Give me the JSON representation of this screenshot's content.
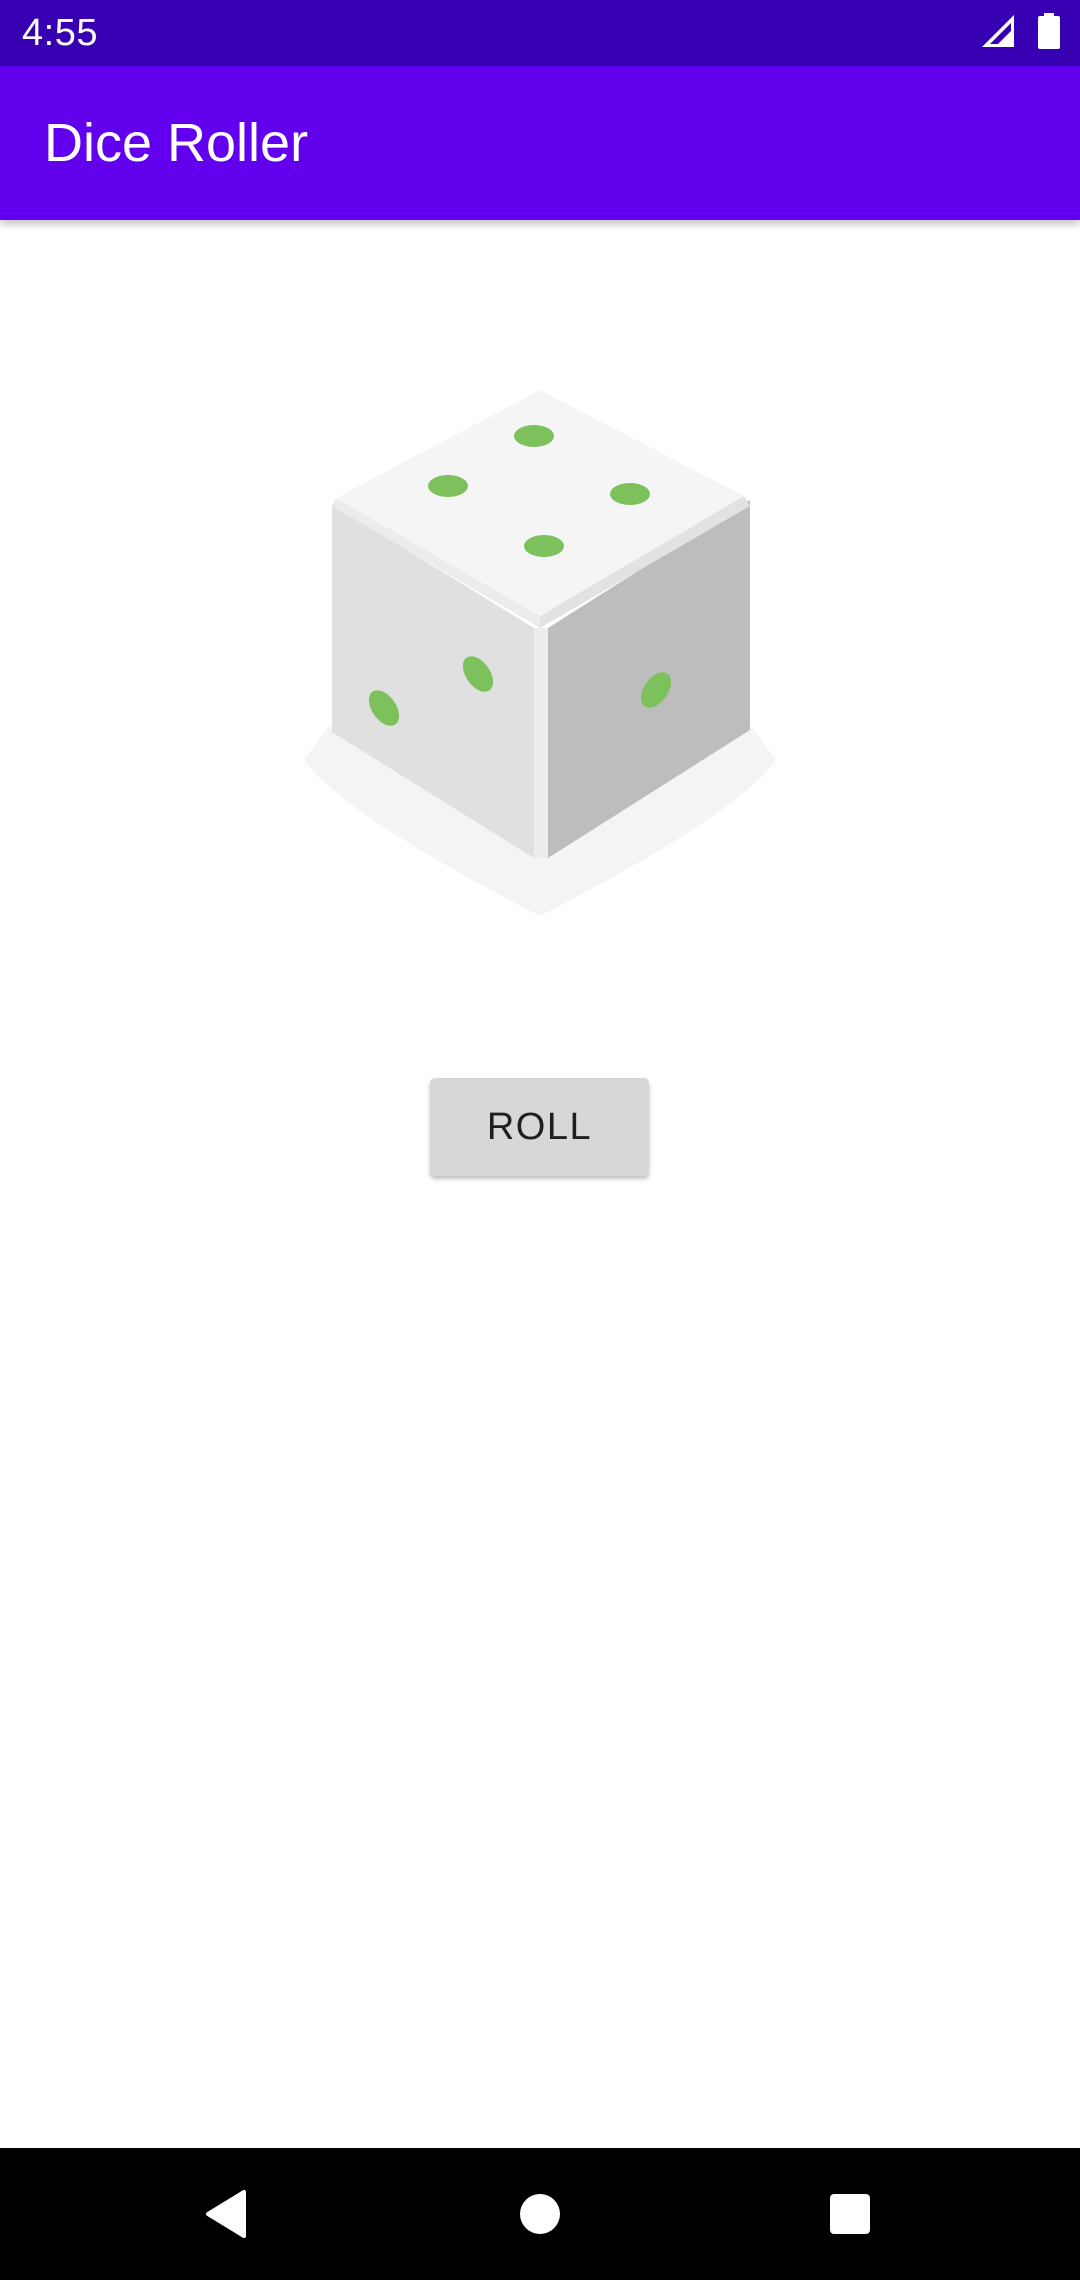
{
  "status_bar": {
    "time": "4:55",
    "icons": [
      "cellular-signal-icon",
      "battery-icon"
    ]
  },
  "app_bar": {
    "title": "Dice Roller"
  },
  "main": {
    "dice_image": {
      "icon": "dice-icon",
      "face_value": 4
    },
    "roll_button_label": "ROLL"
  },
  "nav_bar": {
    "buttons": [
      "back-icon",
      "home-icon",
      "recents-icon"
    ]
  },
  "colors": {
    "status_bar": "#3700B3",
    "app_bar": "#6200EE",
    "dice_pip": "#7CC15B",
    "button": "#D6D7D7",
    "nav_bar": "#000000"
  }
}
